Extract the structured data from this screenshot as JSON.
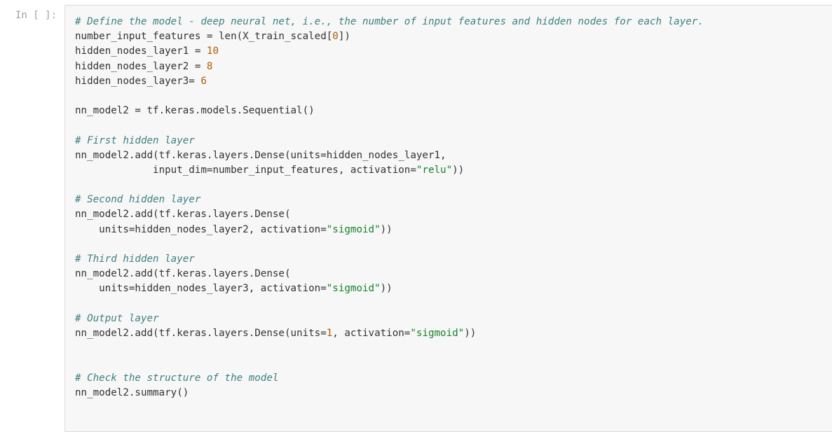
{
  "cell": {
    "prompt": "In [ ]:",
    "lines": [
      [
        {
          "t": "# Define the model - deep neural net, i.e., the number of input features and hidden nodes for each layer.",
          "k": "cm"
        }
      ],
      [
        {
          "t": "number_input_features = len(X_train_scaled[",
          "k": ""
        },
        {
          "t": "0",
          "k": "nm"
        },
        {
          "t": "])",
          "k": ""
        }
      ],
      [
        {
          "t": "hidden_nodes_layer1 = ",
          "k": ""
        },
        {
          "t": "10",
          "k": "nm"
        }
      ],
      [
        {
          "t": "hidden_nodes_layer2 = ",
          "k": ""
        },
        {
          "t": "8",
          "k": "nm"
        }
      ],
      [
        {
          "t": "hidden_nodes_layer3= ",
          "k": ""
        },
        {
          "t": "6",
          "k": "nm"
        }
      ],
      [],
      [
        {
          "t": "nn_model2 = tf.keras.models.Sequential()",
          "k": ""
        }
      ],
      [],
      [
        {
          "t": "# First hidden layer",
          "k": "cm"
        }
      ],
      [
        {
          "t": "nn_model2.add(tf.keras.layers.Dense(units=hidden_nodes_layer1,",
          "k": ""
        }
      ],
      [
        {
          "t": "             input_dim=number_input_features, activation=",
          "k": ""
        },
        {
          "t": "\"relu\"",
          "k": "st"
        },
        {
          "t": "))",
          "k": ""
        }
      ],
      [],
      [
        {
          "t": "# Second hidden layer",
          "k": "cm"
        }
      ],
      [
        {
          "t": "nn_model2.add(tf.keras.layers.Dense(",
          "k": ""
        }
      ],
      [
        {
          "t": "    units=hidden_nodes_layer2, activation=",
          "k": ""
        },
        {
          "t": "\"sigmoid\"",
          "k": "st"
        },
        {
          "t": "))",
          "k": ""
        }
      ],
      [],
      [
        {
          "t": "# Third hidden layer",
          "k": "cm"
        }
      ],
      [
        {
          "t": "nn_model2.add(tf.keras.layers.Dense(",
          "k": ""
        }
      ],
      [
        {
          "t": "    units=hidden_nodes_layer3, activation=",
          "k": ""
        },
        {
          "t": "\"sigmoid\"",
          "k": "st"
        },
        {
          "t": "))",
          "k": ""
        }
      ],
      [],
      [
        {
          "t": "# Output layer",
          "k": "cm"
        }
      ],
      [
        {
          "t": "nn_model2.add(tf.keras.layers.Dense(units=",
          "k": ""
        },
        {
          "t": "1",
          "k": "nm"
        },
        {
          "t": ", activation=",
          "k": ""
        },
        {
          "t": "\"sigmoid\"",
          "k": "st"
        },
        {
          "t": "))",
          "k": ""
        }
      ],
      [],
      [],
      [
        {
          "t": "# Check the structure of the model",
          "k": "cm"
        }
      ],
      [
        {
          "t": "nn_model2.summary()",
          "k": ""
        }
      ]
    ]
  },
  "colors": {
    "comment": "#408080",
    "number": "#b05a00",
    "string": "#16822a",
    "text": "#333333",
    "prompt": "#a0a0a0",
    "cell_background": "#f7f7f7",
    "cell_border": "#dcdcdc"
  }
}
